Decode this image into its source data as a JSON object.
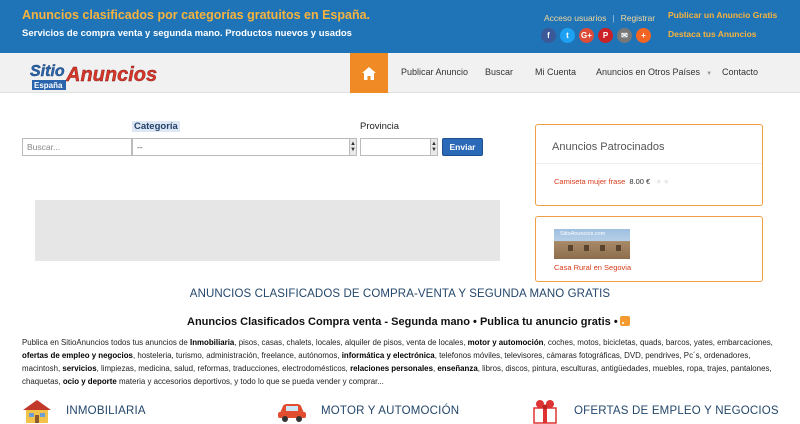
{
  "header": {
    "title": "Anuncios clasificados por categorías gratuitos en España.",
    "subtitle": "Servicios de compra venta y segunda mano. Productos nuevos y usados",
    "links": {
      "login": "Acceso usuarios",
      "separator": "|",
      "register": "Registrar"
    },
    "right_links": {
      "publish": "Publicar un Anuncio Gratis",
      "highlight": "Destaca tus Anuncios"
    },
    "social": [
      {
        "icon": "facebook-icon",
        "glyph": "f",
        "color": "#3b5998"
      },
      {
        "icon": "twitter-icon",
        "glyph": "t",
        "color": "#1da1f2"
      },
      {
        "icon": "google-plus-icon",
        "glyph": "G+",
        "color": "#dd4b39"
      },
      {
        "icon": "pinterest-icon",
        "glyph": "P",
        "color": "#cb2027"
      },
      {
        "icon": "email-icon",
        "glyph": "✉",
        "color": "#777777"
      },
      {
        "icon": "more-icon",
        "glyph": "+",
        "color": "#f26522"
      }
    ]
  },
  "brand": {
    "sitio": "Sitio",
    "anuncios": "Anuncios",
    "espana": "España"
  },
  "nav": {
    "home_icon": "home-icon",
    "items": [
      "Publicar Anuncio",
      "Buscar",
      "Mi Cuenta",
      "Anuncios en Otros Países",
      "Contacto"
    ]
  },
  "search": {
    "category_label": "Categoría",
    "province_label": "Provincia",
    "search_placeholder": "Buscar...",
    "category_value": "--",
    "province_value": "",
    "submit": "Enviar"
  },
  "sponsored": {
    "title": "Anuncios Patrocinados",
    "item": {
      "name": "Camiseta mujer frase",
      "price": "8.00 €"
    },
    "feature": {
      "image_tag": "SitioAnuncios.com",
      "caption": "Casa Rural en Segovia"
    }
  },
  "main": {
    "heading": "ANUNCIOS CLASIFICADOS DE COMPRA-VENTA Y SEGUNDA MANO GRATIS",
    "subheading": "Anuncios Clasificados Compra venta - Segunda mano • Publica tu anuncio gratis •",
    "paragraph": [
      {
        "t": "Publica en SitioAnuncios todos tus anuncios de ",
        "b": false
      },
      {
        "t": "Inmobiliaria",
        "b": true
      },
      {
        "t": ", pisos, casas, chalets, locales, alquiler de pisos, venta de locales, ",
        "b": false
      },
      {
        "t": "motor y automoción",
        "b": true
      },
      {
        "t": ", coches, motos, bicicletas, quads, barcos, yates, embarcaciones, ",
        "b": false
      },
      {
        "t": "ofertas de empleo y negocios",
        "b": true
      },
      {
        "t": ", hosteleria, turismo, administración, freelance, autónomos, ",
        "b": false
      },
      {
        "t": "informática y electrónica",
        "b": true
      },
      {
        "t": ", telefonos móviles, televisores, cámaras fotográficas, DVD, pendrives, Pc´s, ordenadores, macintosh, ",
        "b": false
      },
      {
        "t": "servicios",
        "b": true
      },
      {
        "t": ", limpiezas, medicina, salud, reformas, traducciones, electrodomésticos, ",
        "b": false
      },
      {
        "t": "relaciones personales",
        "b": true
      },
      {
        "t": ", ",
        "b": false
      },
      {
        "t": "enseñanza",
        "b": true
      },
      {
        "t": ", libros, discos, pintura, esculturas, antigüedades, muebles, ropa, trajes, pantalones, chaquetas, ",
        "b": false
      },
      {
        "t": "ocio y deporte",
        "b": true
      },
      {
        "t": " materia y accesorios deportivos, y todo lo que se pueda vender y comprar...",
        "b": false
      }
    ],
    "categories": [
      {
        "label": "INMOBILIARIA",
        "icon": "house-icon"
      },
      {
        "label": "MOTOR Y AUTOMOCIÓN",
        "icon": "car-icon"
      },
      {
        "label": "OFERTAS DE EMPLEO Y NEGOCIOS",
        "icon": "gift-icon"
      }
    ]
  },
  "colors": {
    "header_blue": "#1f74b8",
    "accent_orange": "#f08a24",
    "title_gold": "#f7b33b",
    "link_red": "#d93a1a"
  }
}
